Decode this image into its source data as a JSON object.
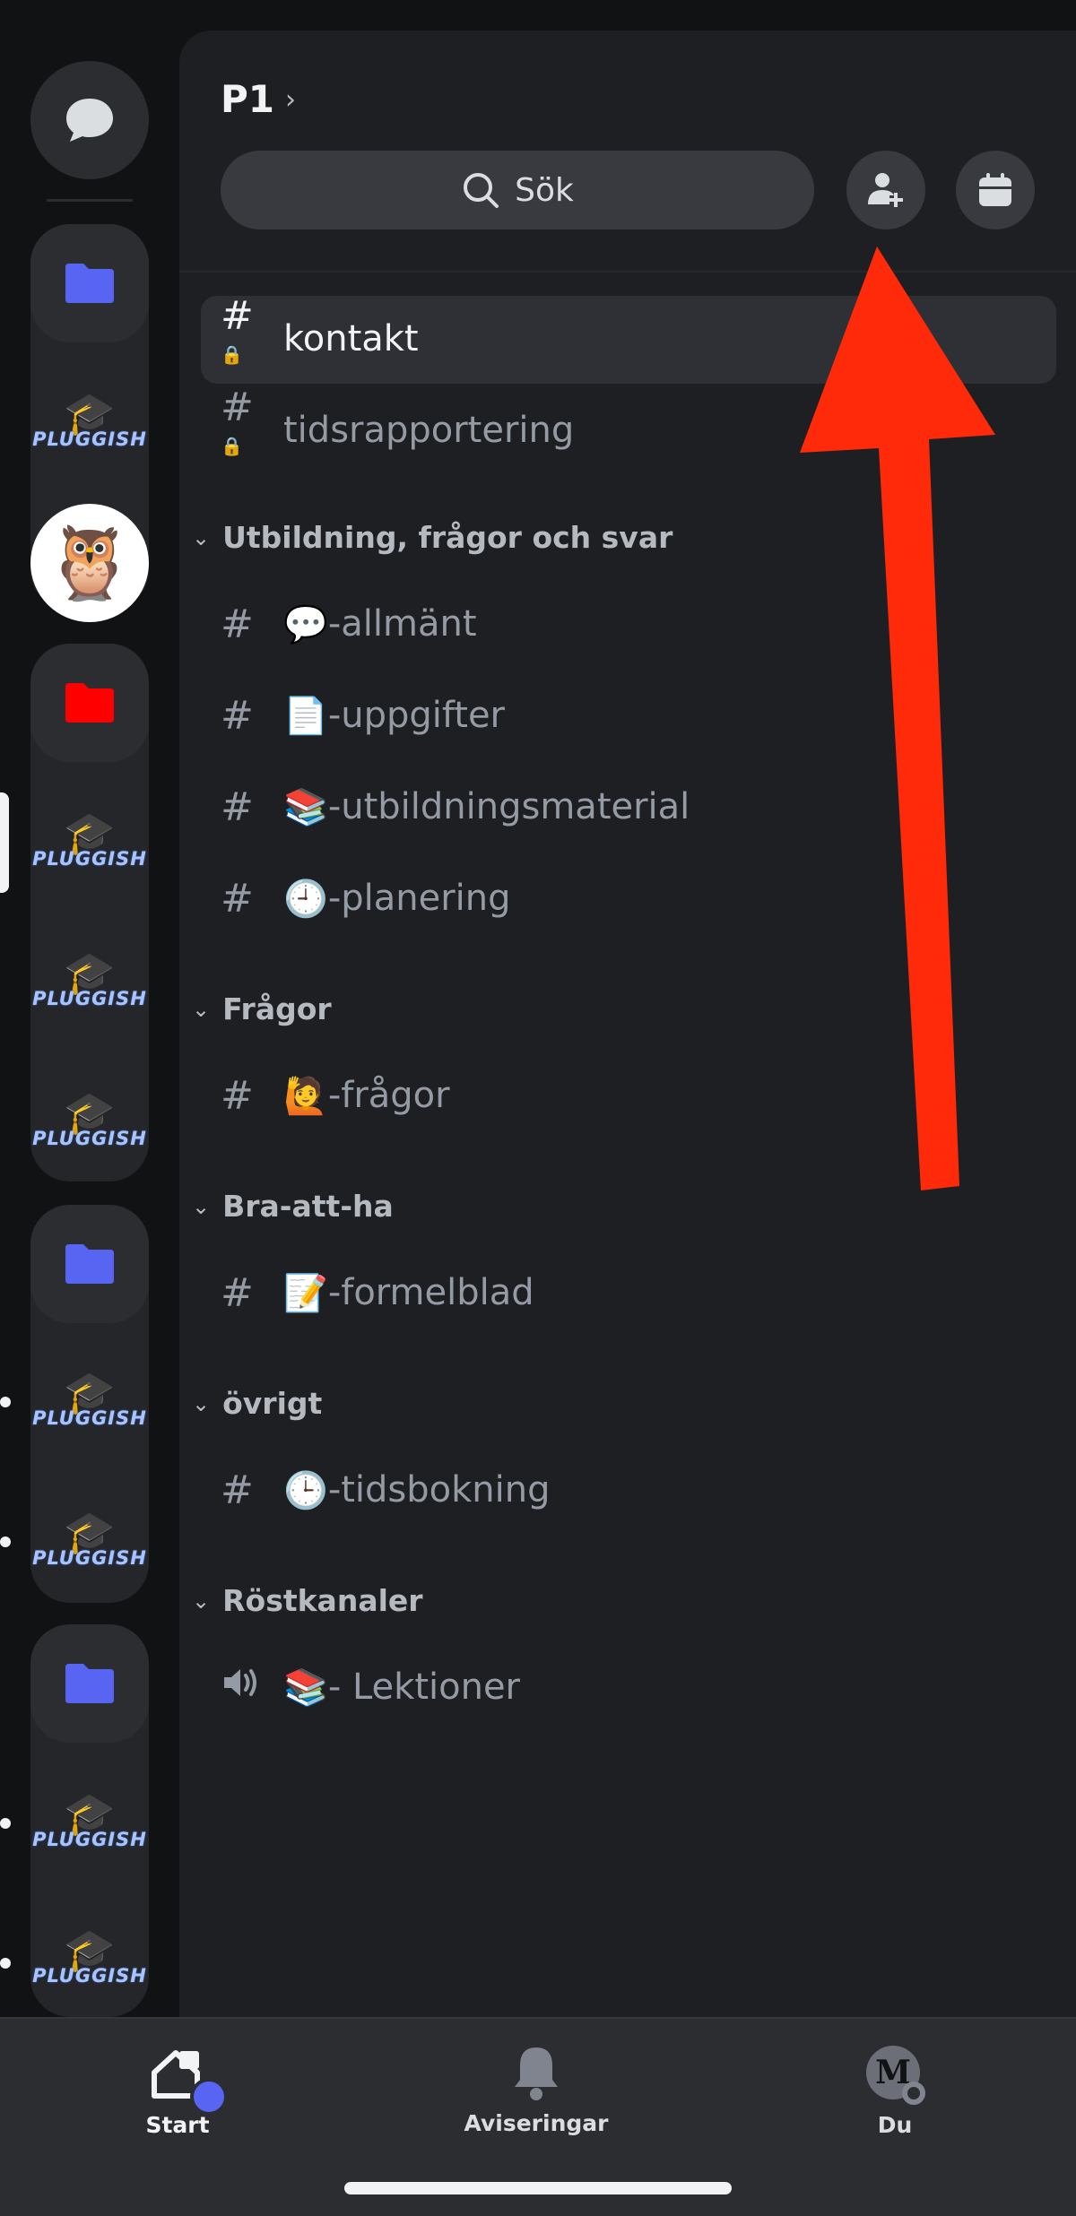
{
  "server": {
    "title": "P1"
  },
  "search": {
    "label": "Sök"
  },
  "top_channels": [
    {
      "name": "kontakt",
      "active": true
    },
    {
      "name": "tidsrapportering",
      "active": false
    }
  ],
  "categories": [
    {
      "label": "Utbildning, frågor och svar",
      "channels": [
        {
          "emoji": "💬",
          "name": "-allmänt"
        },
        {
          "emoji": "📄",
          "name": "-uppgifter"
        },
        {
          "emoji": "📚",
          "name": "-utbildningsmaterial"
        },
        {
          "emoji": "🕘",
          "name": "-planering"
        }
      ]
    },
    {
      "label": "Frågor",
      "channels": [
        {
          "emoji": "🙋",
          "name": "-frågor"
        }
      ]
    },
    {
      "label": "Bra-att-ha",
      "channels": [
        {
          "emoji": "📝",
          "name": "-formelblad"
        }
      ]
    },
    {
      "label": "övrigt",
      "channels": [
        {
          "emoji": "🕒",
          "name": "-tidsbokning"
        }
      ]
    },
    {
      "label": "Röstkanaler",
      "channels": [
        {
          "emoji": "📚",
          "name": "- Lektioner"
        }
      ]
    }
  ],
  "rail": {
    "pluggish_word": "PLUGGISH"
  },
  "tabs": {
    "start": "Start",
    "notifications": "Aviseringar",
    "you": "Du",
    "avatar_letter": "M"
  },
  "colors": {
    "background": "#1e1f22",
    "accent": "#5865f2",
    "arrow": "#ff2a0a",
    "folder_red": "#ff0000"
  },
  "icons": {
    "dm": "chat-bubble-icon",
    "folder": "folder-icon",
    "search": "search-icon",
    "invite": "add-member-icon",
    "events": "calendar-icon",
    "text_channel": "hash-icon",
    "locked_channel": "hash-lock-icon",
    "voice_channel": "speaker-icon",
    "category": "chevron-down-icon",
    "home": "home-icon",
    "notifications": "bell-icon"
  }
}
